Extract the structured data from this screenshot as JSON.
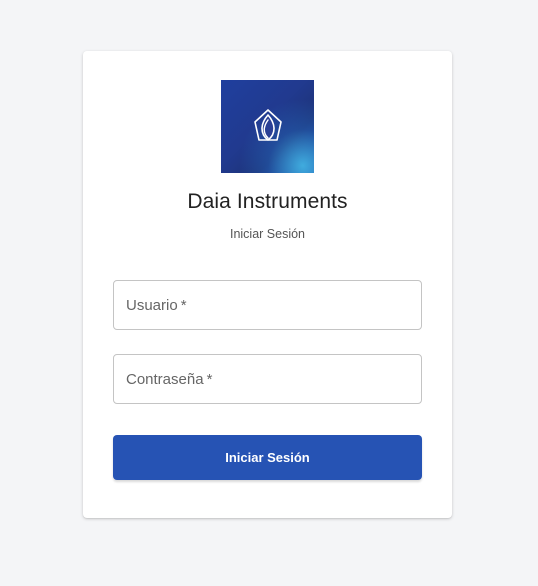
{
  "app": {
    "company_name": "Daia Instruments",
    "subtitle": "Iniciar Sesión",
    "logo_icon": "drop-flame-hexagon-icon"
  },
  "form": {
    "username": {
      "label": "Usuario",
      "required_marker": "*",
      "value": ""
    },
    "password": {
      "label": "Contraseña",
      "required_marker": "*",
      "value": ""
    },
    "submit_label": "Iniciar Sesión"
  },
  "colors": {
    "background": "#f4f5f7",
    "primary": "#2653b4",
    "logo_blue": "#213a8f"
  }
}
